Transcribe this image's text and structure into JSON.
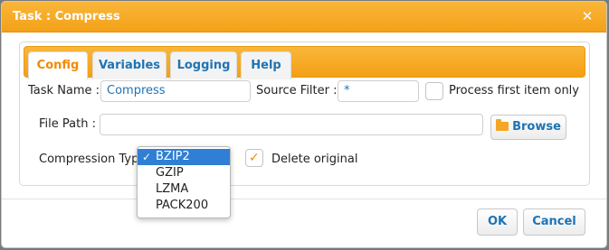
{
  "dialog": {
    "title": "Task : Compress"
  },
  "tabs": [
    {
      "label": "Config",
      "active": true
    },
    {
      "label": "Variables",
      "active": false
    },
    {
      "label": "Logging",
      "active": false
    },
    {
      "label": "Help",
      "active": false
    }
  ],
  "form": {
    "task_name_label": "Task Name :",
    "task_name_value": "Compress",
    "source_filter_label": "Source Filter :",
    "source_filter_value": "*",
    "process_first_label": "Process first item only",
    "process_first_checked": false,
    "file_path_label": "File Path :",
    "file_path_value": "",
    "browse_label": "Browse",
    "compression_type_label": "Compression Type",
    "compression_options": [
      "BZIP2",
      "GZIP",
      "LZMA",
      "PACK200"
    ],
    "compression_selected": "BZIP2",
    "delete_original_label": "Delete original",
    "delete_original_checked": true
  },
  "footer": {
    "ok_label": "OK",
    "cancel_label": "Cancel"
  },
  "colors": {
    "accent": "#f4a118",
    "link": "#1e73b4",
    "selection": "#2f7fd4"
  }
}
